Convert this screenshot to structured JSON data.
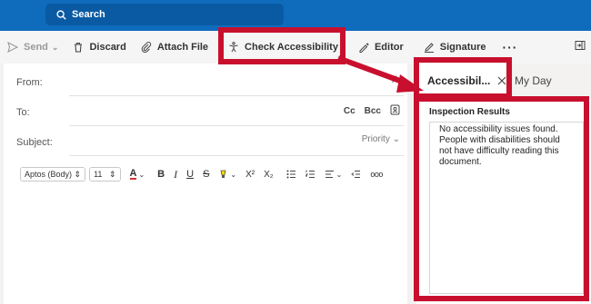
{
  "search": {
    "label": "Search"
  },
  "toolbar": {
    "send": "Send",
    "discard": "Discard",
    "attach_file": "Attach File",
    "check_accessibility": "Check Accessibility",
    "editor": "Editor",
    "signature": "Signature",
    "more": "···"
  },
  "compose": {
    "from_label": "From:",
    "to_label": "To:",
    "subject_label": "Subject:",
    "cc": "Cc",
    "bcc": "Bcc",
    "priority": "Priority"
  },
  "format": {
    "font": "Aptos (Body)",
    "size": "11",
    "color_glyph": "A",
    "bold": "B",
    "italic": "I",
    "underline": "U",
    "strike": "S",
    "superscript": "X²",
    "subscript": "X₂",
    "more": "ooo"
  },
  "pane": {
    "active_tab": "Accessibil...",
    "inactive_tab": "My Day",
    "inspection_title": "Inspection Results",
    "inspection_text": "No accessibility issues found. People with disabilities should not have difficulty reading this document."
  },
  "colors": {
    "brand": "#0f6cbd",
    "highlight": "#c8102e",
    "font_color_bar": "#d13438"
  }
}
